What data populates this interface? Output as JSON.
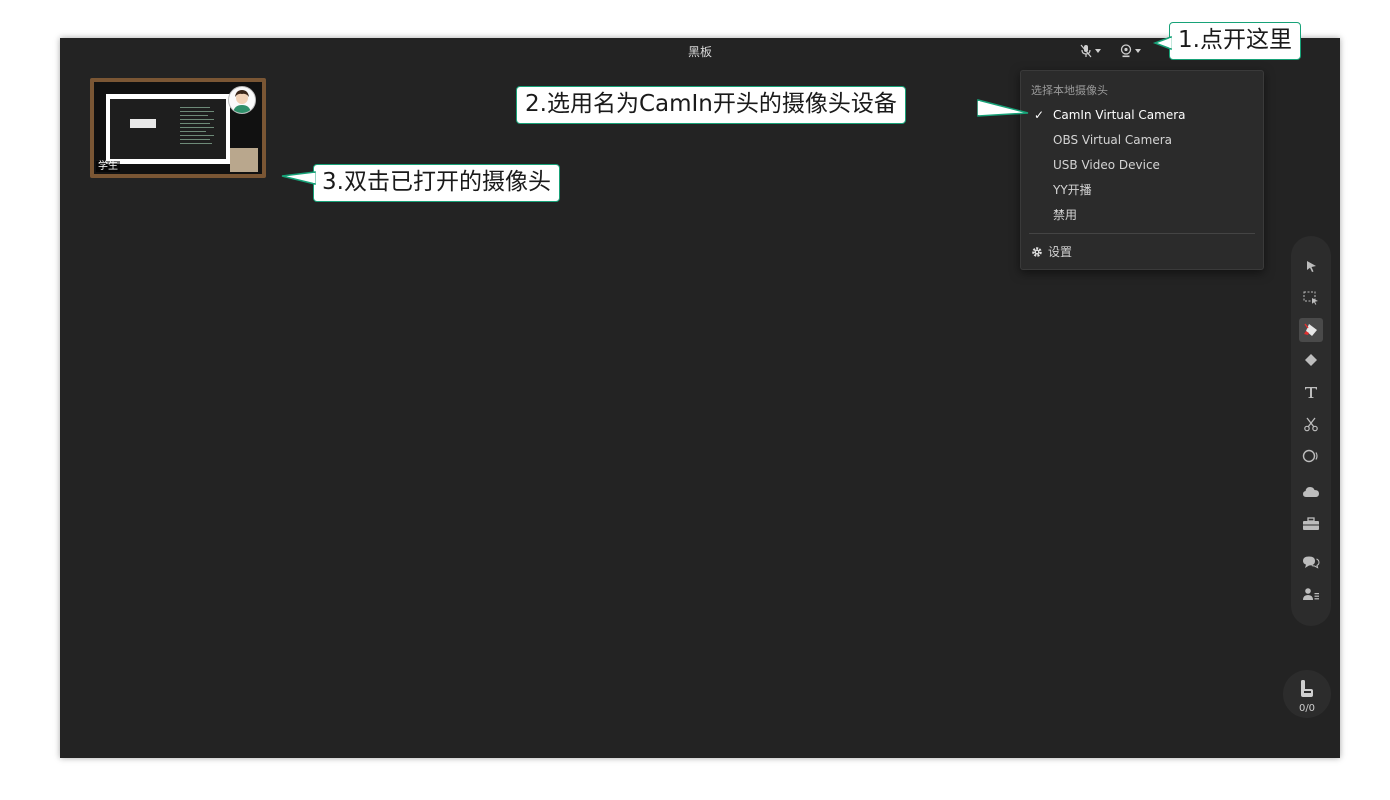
{
  "window": {
    "title": "黑板"
  },
  "titlebar": {
    "mic_icon": "mic-muted-icon",
    "camera_icon": "webcam-icon"
  },
  "camera_preview": {
    "label": "学生"
  },
  "camera_menu": {
    "header": "选择本地摄像头",
    "items": [
      {
        "label": "CamIn Virtual Camera",
        "selected": true
      },
      {
        "label": "OBS Virtual Camera",
        "selected": false
      },
      {
        "label": "USB Video Device",
        "selected": false
      },
      {
        "label": "YY开播",
        "selected": false
      },
      {
        "label": "禁用",
        "selected": false
      }
    ],
    "settings_label": "设置"
  },
  "toolbar": {
    "tools": [
      "pointer-icon",
      "box-select-icon",
      "pen-icon",
      "eraser-icon",
      "text-icon",
      "scissors-icon",
      "shape-icon",
      "cloud-icon",
      "toolbox-icon",
      "chat-icon",
      "users-icon"
    ],
    "hand_count": "0/0"
  },
  "annotations": {
    "step1": "1.点开这里",
    "step2": "2.选用名为CamIn开头的摄像头设备",
    "step3": "3.双击已打开的摄像头"
  },
  "colors": {
    "accent": "#17a278",
    "background": "#232323"
  }
}
